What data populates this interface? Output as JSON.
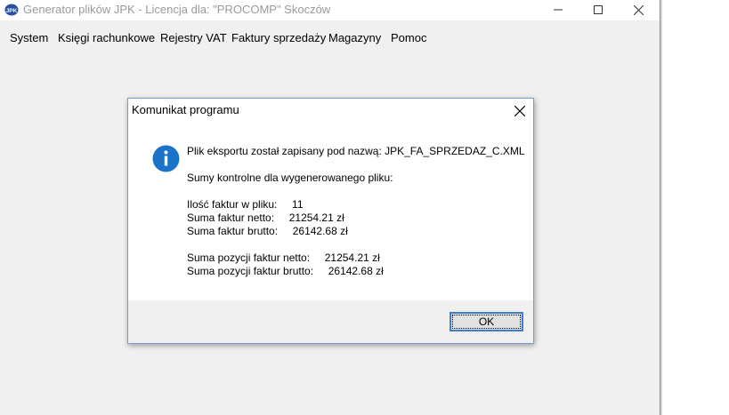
{
  "window": {
    "title": "Generator plików JPK - Licencja dla: \"PROCOMP\" Skoczów",
    "icon": "jpk-app-icon",
    "icon_label": "JPK"
  },
  "menu": {
    "items": [
      {
        "label": "System"
      },
      {
        "label": "Księgi rachunkowe"
      },
      {
        "label": "Rejestry VAT"
      },
      {
        "label": "Faktury sprzedaży"
      },
      {
        "label": "Magazyny"
      },
      {
        "label": "Pomoc"
      }
    ]
  },
  "dialog": {
    "title": "Komunikat programu",
    "icon": "info-icon",
    "line_export": "Plik eksportu został zapisany pod nazwą: JPK_FA_SPRZEDAZ_C.XML",
    "line_sums_header": "Sumy kontrolne dla wygenerowanego pliku:",
    "line_invoice_count": "Ilość faktur w pliku:     11",
    "line_net_sum": "Suma faktur netto:     21254.21 zł",
    "line_gross_sum": "Suma faktur brutto:     26142.68 zł",
    "line_items_net": "Suma pozycji faktur netto:     21254.21 zł",
    "line_items_gross": "Suma pozycji faktur brutto:     26142.68 zł",
    "ok_label": "OK"
  },
  "colors": {
    "accent": "#3c7fd1",
    "info_icon": "#1a73c8",
    "window_bg": "#f0f0f0"
  }
}
